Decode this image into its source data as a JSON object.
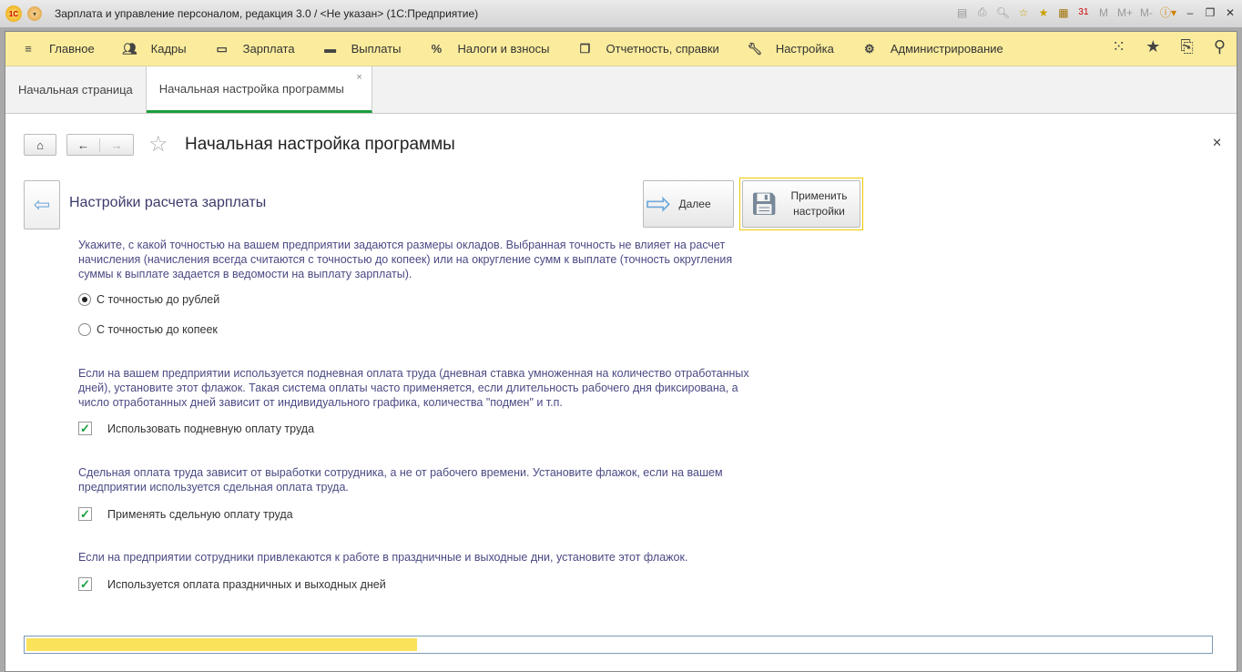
{
  "window": {
    "title": "Зарплата и управление персоналом, редакция 3.0 / <Не указан>  (1С:Предприятие)",
    "logo": "1C",
    "toolbar": [
      "M",
      "M+",
      "M-"
    ]
  },
  "nav": {
    "items": [
      {
        "label": "Главное",
        "icon": "menu-icon"
      },
      {
        "label": "Кадры",
        "icon": "people-icon"
      },
      {
        "label": "Зарплата",
        "icon": "card-icon"
      },
      {
        "label": "Выплаты",
        "icon": "wallet-icon"
      },
      {
        "label": "Налоги и взносы",
        "icon": "percent-icon"
      },
      {
        "label": "Отчетность, справки",
        "icon": "docs-icon"
      },
      {
        "label": "Настройка",
        "icon": "wrench-icon"
      },
      {
        "label": "Администрирование",
        "icon": "gear-icon"
      }
    ]
  },
  "tabs": [
    {
      "label": "Начальная страница"
    },
    {
      "label": "Начальная настройка программы",
      "active": true
    }
  ],
  "page": {
    "title": "Начальная настройка программы",
    "section_title": "Настройки расчета зарплаты",
    "next_label": "Далее",
    "apply_label": "Применить настройки",
    "desc1": "Укажите, с какой точностью на вашем предприятии задаются размеры окладов. Выбранная точность не влияет на расчет начисления (начисления всегда считаются с точностью до копеек) или на округление сумм к выплате (точность округления суммы к выплате задается в ведомости на выплату зарплаты).",
    "radio1": "С точностью до рублей",
    "radio2": "С точностью до копеек",
    "radio_selected": 1,
    "desc2": "Если на вашем предприятии используется подневная оплата труда (дневная ставка умноженная на количество отработанных дней), установите этот флажок. Такая система оплаты часто применяется, если длительность рабочего дня фиксирована, а число отработанных дней зависит от индивидуального графика, количества \"подмен\" и т.п.",
    "check1": "Использовать подневную оплату труда",
    "desc3": "Сдельная оплата труда зависит от выработки сотрудника, а не от рабочего времени. Установите флажок, если на вашем предприятии используется сдельная оплата труда.",
    "check2": "Применять сдельную оплату труда",
    "desc4": "Если на предприятии сотрудники привлекаются к работе в праздничные и выходные дни, установите этот флажок.",
    "check3": "Используется оплата праздничных и выходных дней",
    "checks_state": [
      true,
      true,
      true
    ],
    "progress_percent": 33
  },
  "colors": {
    "accent": "#1a9e3c",
    "nav_bg": "#fbec9d",
    "progress": "#fae25a"
  }
}
